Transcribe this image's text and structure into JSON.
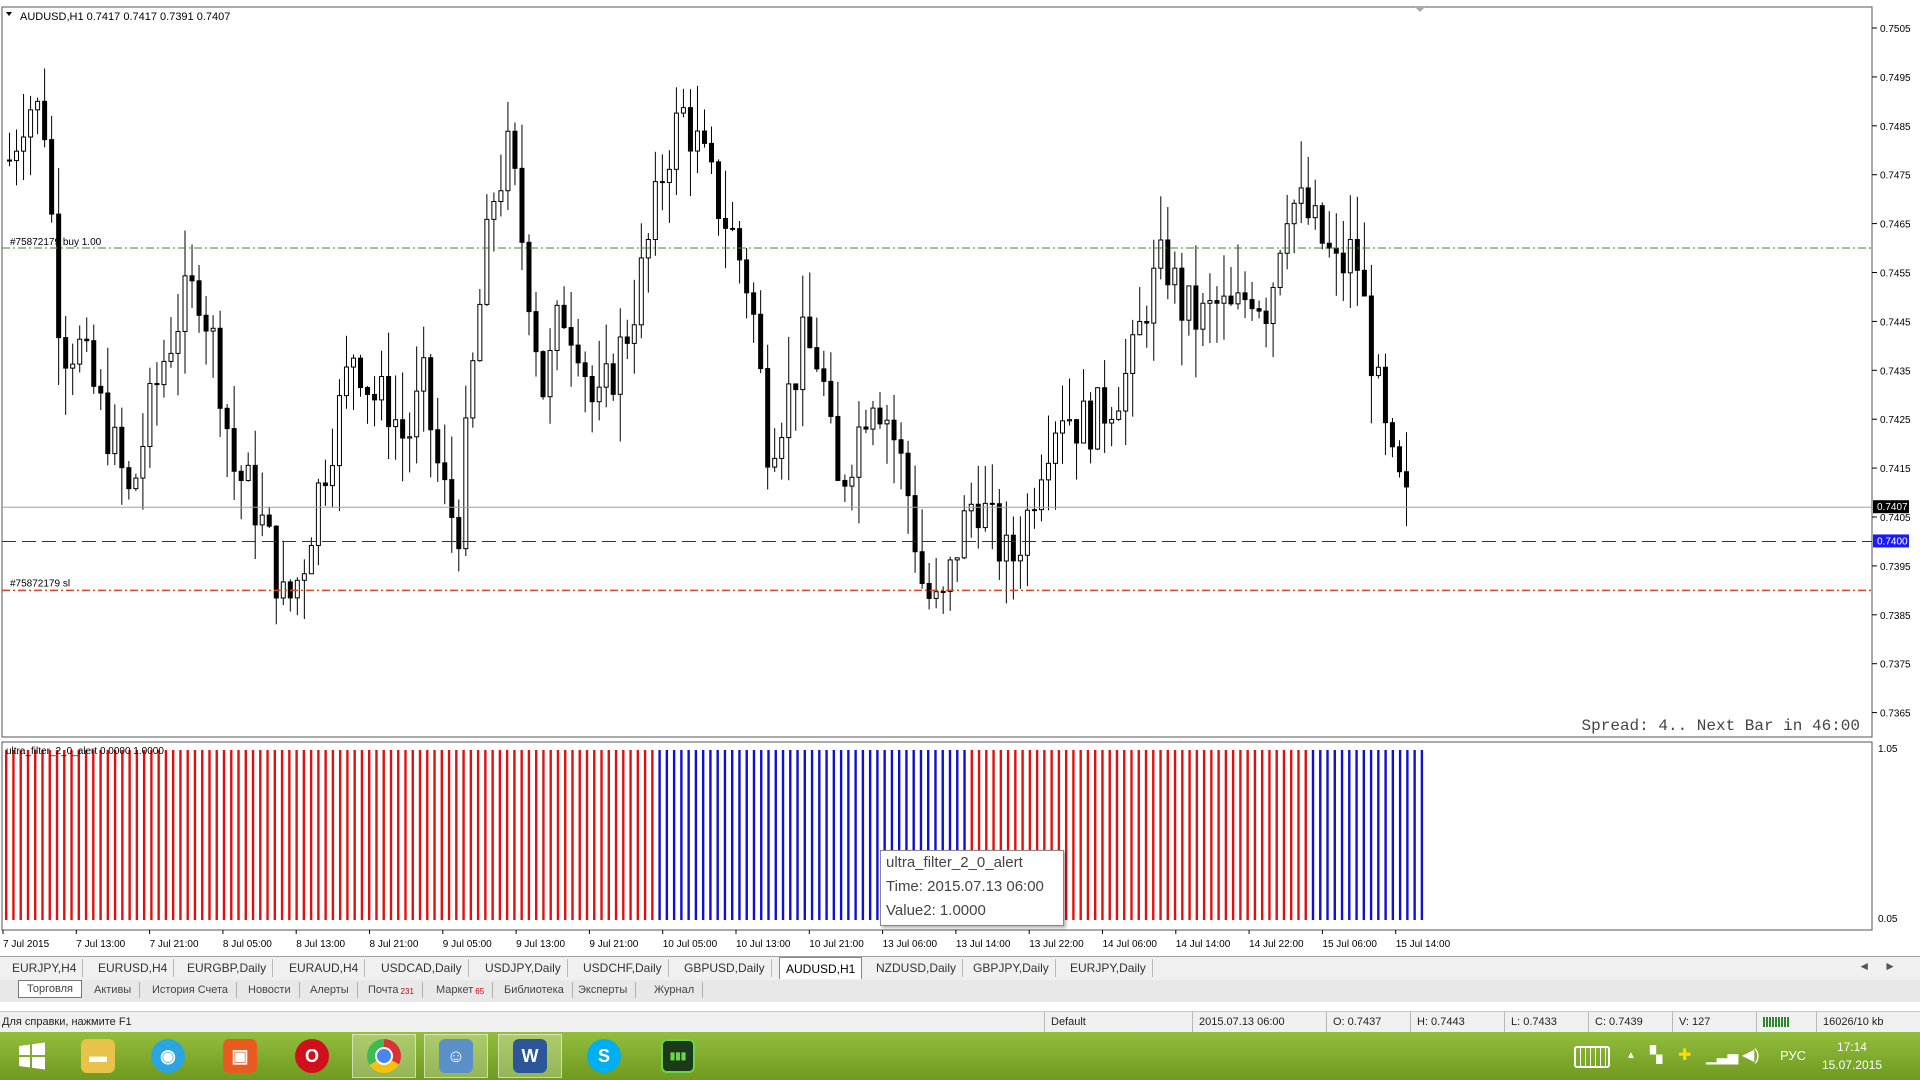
{
  "chart": {
    "header": "AUDUSD,H1  0.7417 0.7417 0.7391 0.7407",
    "buy_label": "#75872179 buy 1.00",
    "sl_label": "#75872179 sl",
    "spread_text": "Spread: 4.. Next Bar in 46:00",
    "current_price": "0.7407",
    "order_price": "0.7400",
    "colors": {
      "buy_line": "#2e8b2e",
      "sl_line": "#e0401a",
      "order_line": "#2020c0",
      "bull": "#ffffff",
      "bear": "#000000"
    }
  },
  "price_axis": [
    "0.7505",
    "0.7495",
    "0.7485",
    "0.7475",
    "0.7465",
    "0.7455",
    "0.7445",
    "0.7435",
    "0.7425",
    "0.7415",
    "0.7405",
    "0.7395",
    "0.7385",
    "0.7375",
    "0.7365"
  ],
  "indicator": {
    "label": "ultra_filter_2_0_alert 0.0000 1.0000",
    "axis_top": "1.05",
    "axis_bottom": "0.05",
    "colors": {
      "red": "#e01010",
      "blue": "#1010d0"
    },
    "segments": [
      {
        "color": "red",
        "count": 90
      },
      {
        "color": "blue",
        "count": 43
      },
      {
        "color": "red",
        "count": 47
      },
      {
        "color": "blue",
        "count": 16
      }
    ]
  },
  "time_axis": [
    "7 Jul 2015",
    "7 Jul 13:00",
    "7 Jul 21:00",
    "8 Jul 05:00",
    "8 Jul 13:00",
    "8 Jul 21:00",
    "9 Jul 05:00",
    "9 Jul 13:00",
    "9 Jul 21:00",
    "10 Jul 05:00",
    "10 Jul 13:00",
    "10 Jul 21:00",
    "13 Jul 06:00",
    "13 Jul 14:00",
    "13 Jul 22:00",
    "14 Jul 06:00",
    "14 Jul 14:00",
    "14 Jul 22:00",
    "15 Jul 06:00",
    "15 Jul 14:00"
  ],
  "tooltip": {
    "line1": "ultra_filter_2_0_alert",
    "line2": "Time: 2015.07.13 06:00",
    "line3": "Value2: 1.0000"
  },
  "symbol_tabs": [
    "EURJPY,H4",
    "EURUSD,H4",
    "EURGBP,Daily",
    "EURAUD,H4",
    "USDCAD,Daily",
    "USDJPY,Daily",
    "USDCHF,Daily",
    "GBPUSD,Daily",
    "AUDUSD,H1",
    "NZDUSD,Daily",
    "GBPJPY,Daily",
    "EURJPY,Daily"
  ],
  "active_symbol_tab": "AUDUSD,H1",
  "terminal_tabs": [
    {
      "label": "Торговля"
    },
    {
      "label": "Активы"
    },
    {
      "label": "История Счета"
    },
    {
      "label": "Новости"
    },
    {
      "label": "Алерты"
    },
    {
      "label": "Почта",
      "badge": "231"
    },
    {
      "label": "Маркет",
      "badge": "65"
    },
    {
      "label": "Библиотека"
    },
    {
      "label": "Эксперты"
    },
    {
      "label": "Журнал"
    }
  ],
  "status_bar": {
    "help": "Для справки, нажмите F1",
    "profile": "Default",
    "datetime": "2015.07.13 06:00",
    "open": "O: 0.7437",
    "high": "H: 0.7443",
    "low": "L: 0.7433",
    "close": "C: 0.7439",
    "volume": "V: 127",
    "traffic": "16026/10 kb"
  },
  "taskbar": {
    "lang": "РУС",
    "time": "17:14",
    "date": "15.07.2015"
  }
}
